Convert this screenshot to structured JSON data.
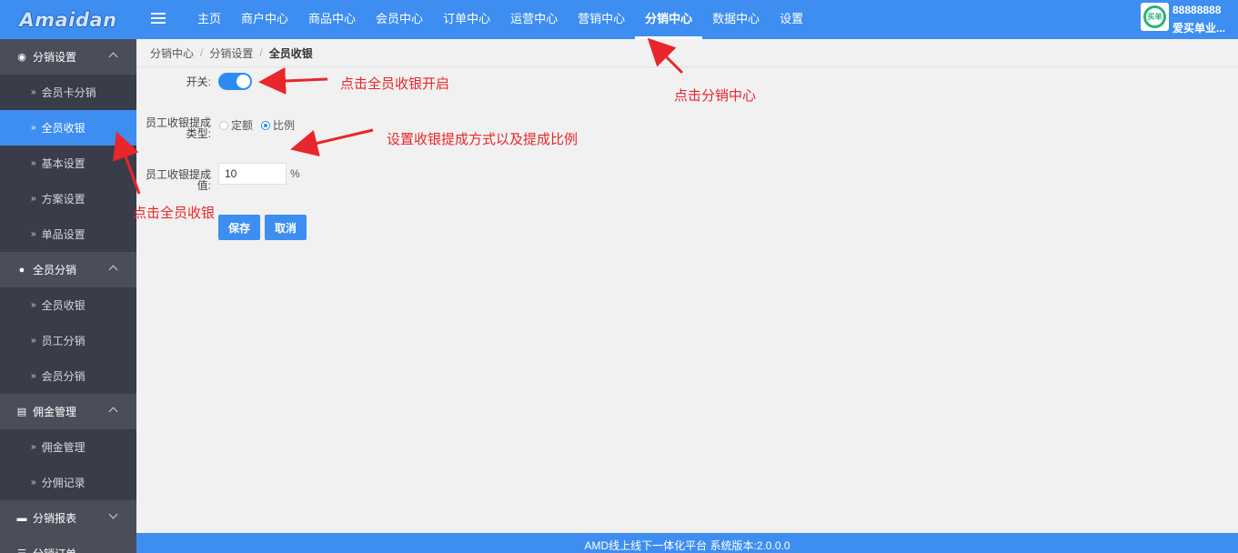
{
  "header": {
    "logo": "Amaidan",
    "nav": [
      "主页",
      "商户中心",
      "商品中心",
      "会员中心",
      "订单中心",
      "运营中心",
      "营销中心",
      "分销中心",
      "数据中心",
      "设置"
    ],
    "active_nav_index": 7,
    "user": {
      "id": "88888888",
      "name": "爱买单业...",
      "avatar_text": "买单"
    }
  },
  "sidebar": {
    "groups": [
      {
        "label": "分销设置",
        "icon": "users-icon",
        "expanded": true,
        "items": [
          "会员卡分销",
          "全员收银",
          "基本设置",
          "方案设置",
          "单品设置"
        ]
      },
      {
        "label": "全员分销",
        "icon": "user-icon",
        "expanded": true,
        "items": [
          "全员收银",
          "员工分销",
          "会员分销"
        ]
      },
      {
        "label": "佣金管理",
        "icon": "database-icon",
        "expanded": true,
        "items": [
          "佣金管理",
          "分佣记录"
        ]
      },
      {
        "label": "分销报表",
        "icon": "card-icon",
        "expanded": false,
        "items": []
      },
      {
        "label": "分销订单",
        "icon": "list-icon",
        "expanded": false,
        "items": []
      }
    ],
    "active_item": "全员收银"
  },
  "breadcrumb": [
    "分销中心",
    "分销设置",
    "全员收银"
  ],
  "form": {
    "switch_label": "开关:",
    "switch_on": true,
    "type_label_1": "员工收银提成",
    "type_label_2": "类型:",
    "type_options": [
      "定额",
      "比例"
    ],
    "type_selected": "比例",
    "value_label_1": "员工收银提成",
    "value_label_2": "值:",
    "value": "10",
    "unit": "%",
    "save_label": "保存",
    "cancel_label": "取消"
  },
  "footer": "AMD线上线下一体化平台 系统版本:2.0.0.0",
  "annotations": {
    "switch_note": "点击全员收银开启",
    "nav_note": "点击分销中心",
    "type_note": "设置收银提成方式以及提成比例",
    "sidebar_note": "点击全员收银"
  },
  "colors": {
    "primary": "#3d8ef0",
    "sidebar": "#393d49",
    "annotation": "#e8262b"
  }
}
